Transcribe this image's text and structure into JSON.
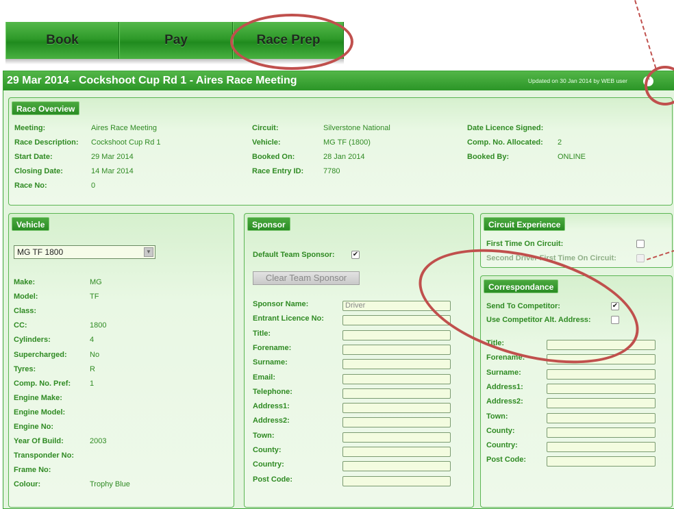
{
  "tabs": [
    {
      "label": "Book"
    },
    {
      "label": "Pay"
    },
    {
      "label": "Race Prep"
    }
  ],
  "header": {
    "title": "29 Mar 2014 - Cockshoot Cup Rd 1 - Aires Race Meeting",
    "updated": "Updated on 30 Jan 2014 by WEB user",
    "collapse_icon": "chevrons-up-icon"
  },
  "race_overview": {
    "title": "Race Overview",
    "col1": [
      {
        "label": "Meeting:",
        "value": "Aires Race Meeting"
      },
      {
        "label": "Race Description:",
        "value": "Cockshoot Cup Rd 1"
      },
      {
        "label": "Start Date:",
        "value": "29 Mar 2014"
      },
      {
        "label": "Closing Date:",
        "value": "14 Mar 2014"
      },
      {
        "label": "Race No:",
        "value": "0"
      }
    ],
    "col2": [
      {
        "label": "Circuit:",
        "value": "Silverstone National"
      },
      {
        "label": "Vehicle:",
        "value": "MG TF (1800)"
      },
      {
        "label": "Booked On:",
        "value": "28 Jan 2014"
      },
      {
        "label": "Race Entry ID:",
        "value": "7780"
      }
    ],
    "col3": [
      {
        "label": "Date Licence Signed:",
        "value": ""
      },
      {
        "label": "Comp. No. Allocated:",
        "value": "2"
      },
      {
        "label": "Booked By:",
        "value": "ONLINE"
      }
    ]
  },
  "vehicle": {
    "title": "Vehicle",
    "selected": "MG TF 1800",
    "rows": [
      {
        "label": "Make:",
        "value": "MG"
      },
      {
        "label": "Model:",
        "value": "TF"
      },
      {
        "label": "Class:",
        "value": ""
      },
      {
        "label": "CC:",
        "value": "1800"
      },
      {
        "label": "Cylinders:",
        "value": "4"
      },
      {
        "label": "Supercharged:",
        "value": "No"
      },
      {
        "label": "Tyres:",
        "value": "R"
      },
      {
        "label": "Comp. No. Pref:",
        "value": "1"
      },
      {
        "label": "Engine Make:",
        "value": ""
      },
      {
        "label": "Engine Model:",
        "value": ""
      },
      {
        "label": "Engine No:",
        "value": ""
      },
      {
        "label": "Year Of Build:",
        "value": "2003"
      },
      {
        "label": "Transponder No:",
        "value": ""
      },
      {
        "label": "Frame No:",
        "value": ""
      },
      {
        "label": "Colour:",
        "value": "Trophy Blue"
      }
    ]
  },
  "sponsor": {
    "title": "Sponsor",
    "default_label": "Default Team Sponsor:",
    "default_checked": "✔",
    "clear_button": "Clear Team Sponsor",
    "fields": [
      {
        "label": "Sponsor Name:",
        "value": "Driver"
      },
      {
        "label": "Entrant Licence No:",
        "value": ""
      },
      {
        "label": "Title:",
        "value": ""
      },
      {
        "label": "Forename:",
        "value": ""
      },
      {
        "label": "Surname:",
        "value": ""
      },
      {
        "label": "Email:",
        "value": ""
      },
      {
        "label": "Telephone:",
        "value": ""
      },
      {
        "label": "Address1:",
        "value": ""
      },
      {
        "label": "Address2:",
        "value": ""
      },
      {
        "label": "Town:",
        "value": ""
      },
      {
        "label": "County:",
        "value": ""
      },
      {
        "label": "Country:",
        "value": ""
      },
      {
        "label": "Post Code:",
        "value": ""
      }
    ]
  },
  "circuit_experience": {
    "title": "Circuit Experience",
    "first_time_label": "First Time On Circuit:",
    "second_driver_label": "Second Driver First Time On Circuit:"
  },
  "correspondance": {
    "title": "Correspondance",
    "send_label": "Send To Competitor:",
    "send_checked": "✔",
    "alt_label": "Use Competitor Alt. Address:",
    "fields": [
      {
        "label": "Title:"
      },
      {
        "label": "Forename:"
      },
      {
        "label": "Surname:"
      },
      {
        "label": "Address1:"
      },
      {
        "label": "Address2:"
      },
      {
        "label": "Town:"
      },
      {
        "label": "County:"
      },
      {
        "label": "Country:"
      },
      {
        "label": "Post Code:"
      }
    ]
  },
  "colors": {
    "accent": "#2b9527",
    "panel_bg": "#e4f5df",
    "label_green": "#2f8a23",
    "annotation": "#c0504d"
  }
}
